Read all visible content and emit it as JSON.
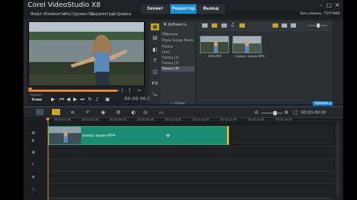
{
  "app": {
    "title": "Corel VideoStudio X8",
    "window_controls": [
      "–",
      "□",
      "✕"
    ]
  },
  "menu": [
    "Файл",
    "Изменить",
    "Инструменты",
    "Параметры",
    "Справка"
  ],
  "stage_tabs": [
    "Захват",
    "Редактор",
    "Вывод"
  ],
  "active_stage_tab": "Редактор",
  "project_info": "Без имени, 720*480",
  "preview": {
    "project_label": "Проект",
    "clip_label": "Клип",
    "timecode": "00:00:00:00",
    "progress": 0.98
  },
  "library": {
    "add_label": "Добавить",
    "folders": [
      "Образцы",
      "Triple Scoop Music",
      "Папка",
      "свет",
      "Папка (1)",
      "Папка (2)",
      "Папка (4)"
    ],
    "active_folder": "Папка (4)",
    "browse_label": "Обзор",
    "options_label": "Options",
    "media": [
      {
        "name": "005.MP4"
      },
      {
        "name": "реверс видео.MP4"
      }
    ]
  },
  "timeline": {
    "ruler": [
      "00:00:00:00",
      "00:00:02:00",
      "00:00:04:00",
      "00:00:06:00",
      "00:00:08:00",
      "00:00:10:00",
      "00:00:12:00",
      "00:00:14:00",
      "00:00:16:00"
    ],
    "clip_name": "реверс видео.MP4"
  },
  "colors": {
    "accent": "#1a8fd6",
    "clip": "#1a8c72",
    "playhead": "#f08a1c"
  }
}
